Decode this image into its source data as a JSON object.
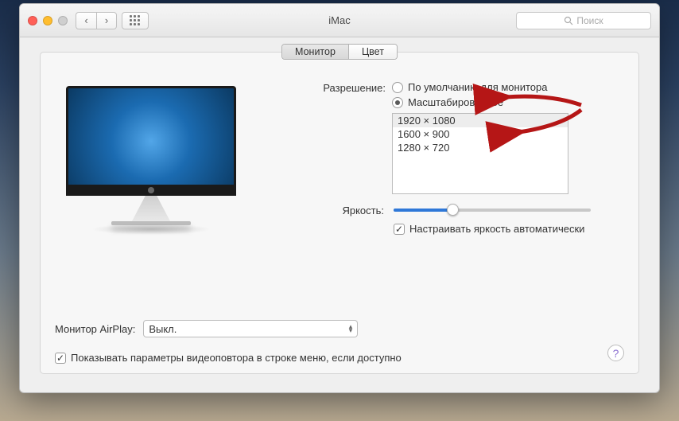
{
  "window": {
    "title": "iMac"
  },
  "search": {
    "placeholder": "Поиск"
  },
  "tabs": {
    "monitor": "Монитор",
    "color": "Цвет"
  },
  "resolution": {
    "label": "Разрешение:",
    "default": "По умолчанию для монитора",
    "scaled": "Масштабированное",
    "options": {
      "r0": "1920 × 1080",
      "r1": "1600 × 900",
      "r2": "1280 × 720"
    }
  },
  "brightness": {
    "label": "Яркость:",
    "auto": "Настраивать яркость автоматически"
  },
  "airplay": {
    "label": "Монитор AirPlay:",
    "value": "Выкл."
  },
  "mirror": {
    "label": "Показывать параметры видеоповтора в строке меню, если доступно"
  }
}
